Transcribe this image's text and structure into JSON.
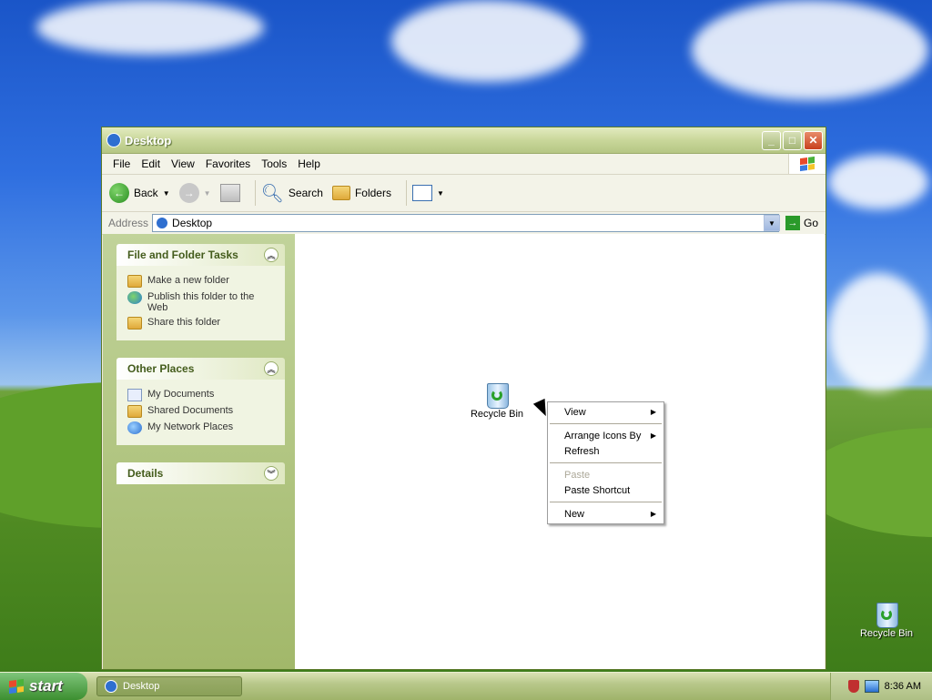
{
  "window": {
    "title": "Desktop"
  },
  "menubar": {
    "items": [
      "File",
      "Edit",
      "View",
      "Favorites",
      "Tools",
      "Help"
    ]
  },
  "toolbar": {
    "back_label": "Back",
    "search_label": "Search",
    "folders_label": "Folders"
  },
  "address": {
    "label": "Address",
    "value": "Desktop",
    "go_label": "Go"
  },
  "taskpane": {
    "file_folder_tasks": {
      "title": "File and Folder Tasks",
      "items": [
        "Make a new folder",
        "Publish this folder to the Web",
        "Share this folder"
      ]
    },
    "other_places": {
      "title": "Other Places",
      "items": [
        "My Documents",
        "Shared Documents",
        "My Network Places"
      ]
    },
    "details": {
      "title": "Details"
    }
  },
  "content_icon": {
    "label": "Recycle Bin"
  },
  "desktop_icon": {
    "label": "Recycle Bin"
  },
  "context_menu": {
    "items": [
      {
        "label": "View",
        "submenu": true
      },
      {
        "label": "Arrange Icons By",
        "submenu": true
      },
      {
        "label": "Refresh"
      },
      {
        "label": "Paste",
        "disabled": true
      },
      {
        "label": "Paste Shortcut"
      },
      {
        "label": "New",
        "submenu": true
      }
    ]
  },
  "taskbar": {
    "start_label": "start",
    "task_label": "Desktop",
    "clock": "8:36 AM"
  },
  "colors": {
    "xp_olive": "#b5c684",
    "start_green": "#3c8f30"
  }
}
